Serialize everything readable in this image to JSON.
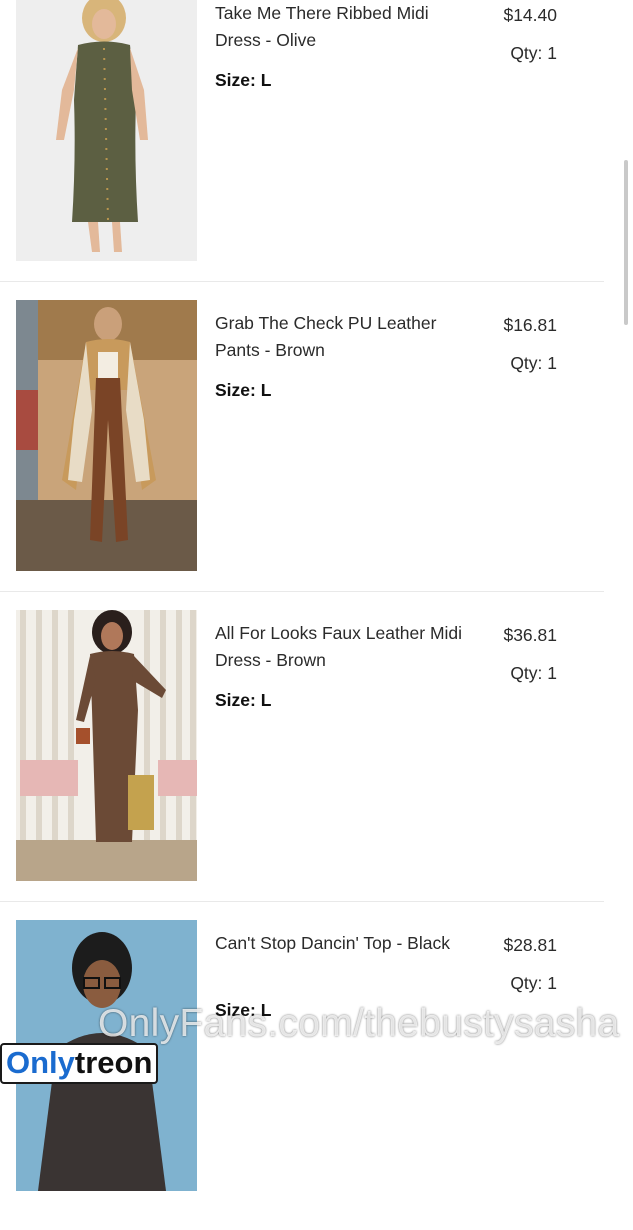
{
  "order_items": [
    {
      "name": "Take Me There Ribbed Midi Dress - Olive",
      "size_label": "Size: L",
      "price": "$14.40",
      "qty_label": "Qty: 1",
      "image_icon": "olive-dress-photo"
    },
    {
      "name": "Grab The Check PU Leather Pants - Brown",
      "size_label": "Size: L",
      "price": "$16.81",
      "qty_label": "Qty: 1",
      "image_icon": "leather-pants-photo"
    },
    {
      "name": "All For Looks Faux Leather Midi Dress - Brown",
      "size_label": "Size: L",
      "price": "$36.81",
      "qty_label": "Qty: 1",
      "image_icon": "faux-leather-dress-photo"
    },
    {
      "name": "Can't Stop Dancin' Top - Black",
      "size_label": "Size: L",
      "price": "$28.81",
      "qty_label": "Qty: 1",
      "image_icon": "black-top-photo"
    }
  ],
  "watermark": {
    "text": "OnlyFans.com/thebustysasha",
    "logo_part1": "Only",
    "logo_part2": "treon"
  },
  "colors": {
    "logo_blue": "#1a6bcf",
    "divider": "#e9e9e9"
  }
}
